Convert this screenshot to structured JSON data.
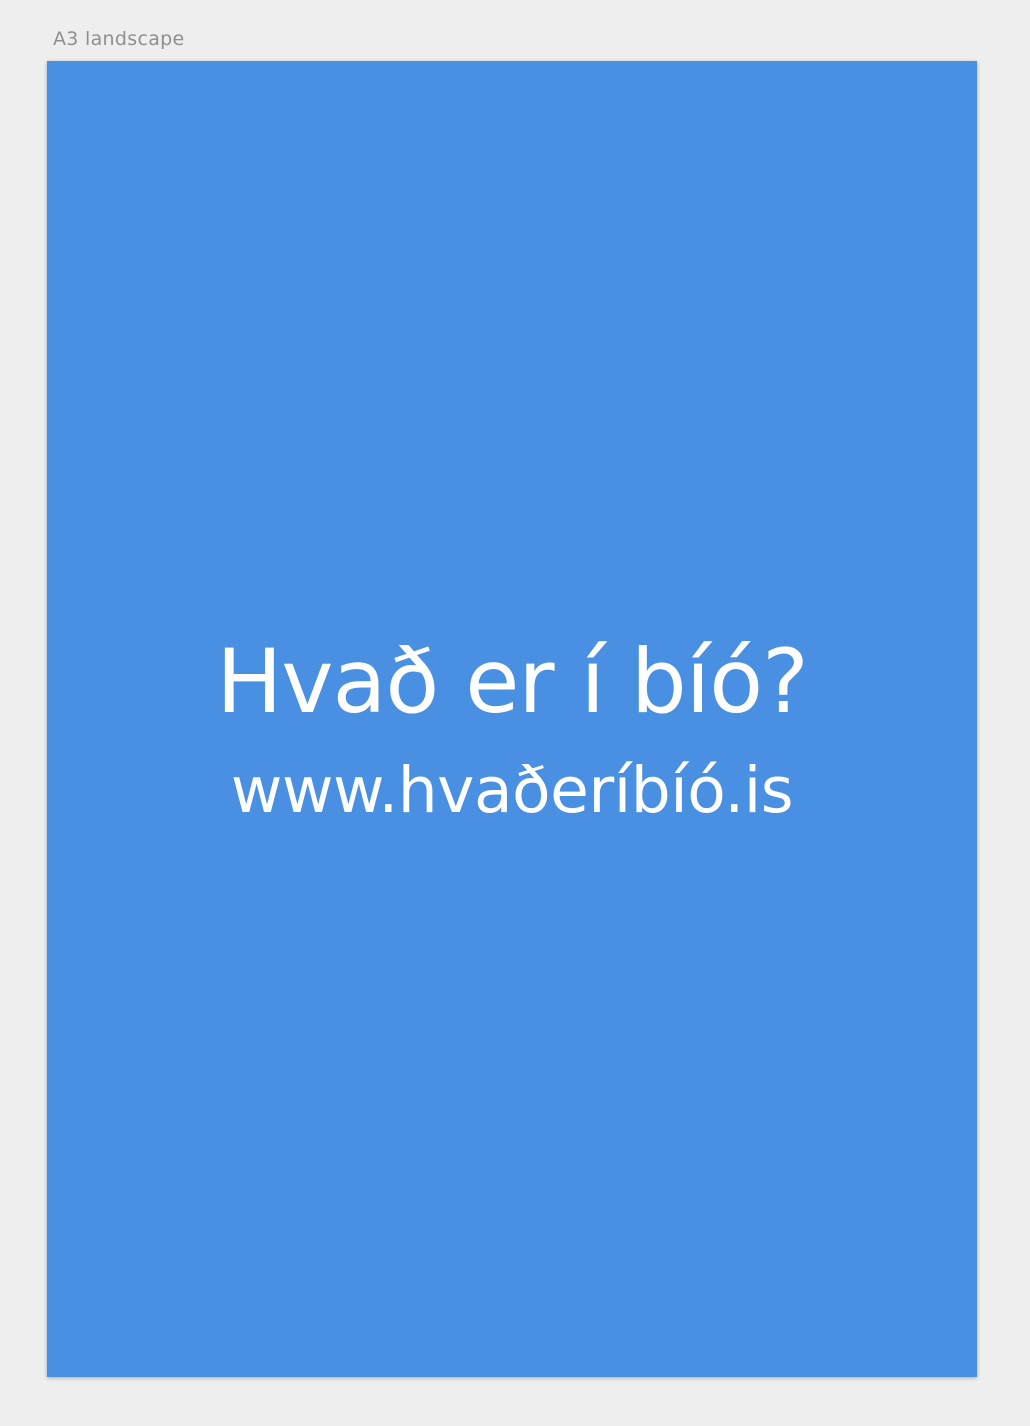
{
  "artboard": {
    "label": "A3 landscape",
    "background_color": "#4a90e2"
  },
  "poster": {
    "headline": "Hvað er í bíó?",
    "url": "www.hvaðeríbíó.is",
    "text_color": "#ffffff"
  },
  "canvas": {
    "background_color": "#eeeeee"
  }
}
